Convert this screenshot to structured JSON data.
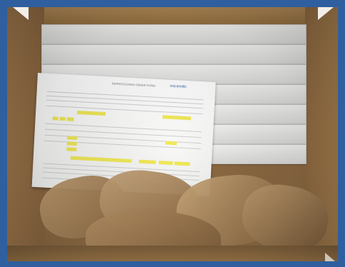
{
  "form": {
    "title": "REPROCESSING ORDER FORM",
    "logo_text": "rescientific"
  }
}
